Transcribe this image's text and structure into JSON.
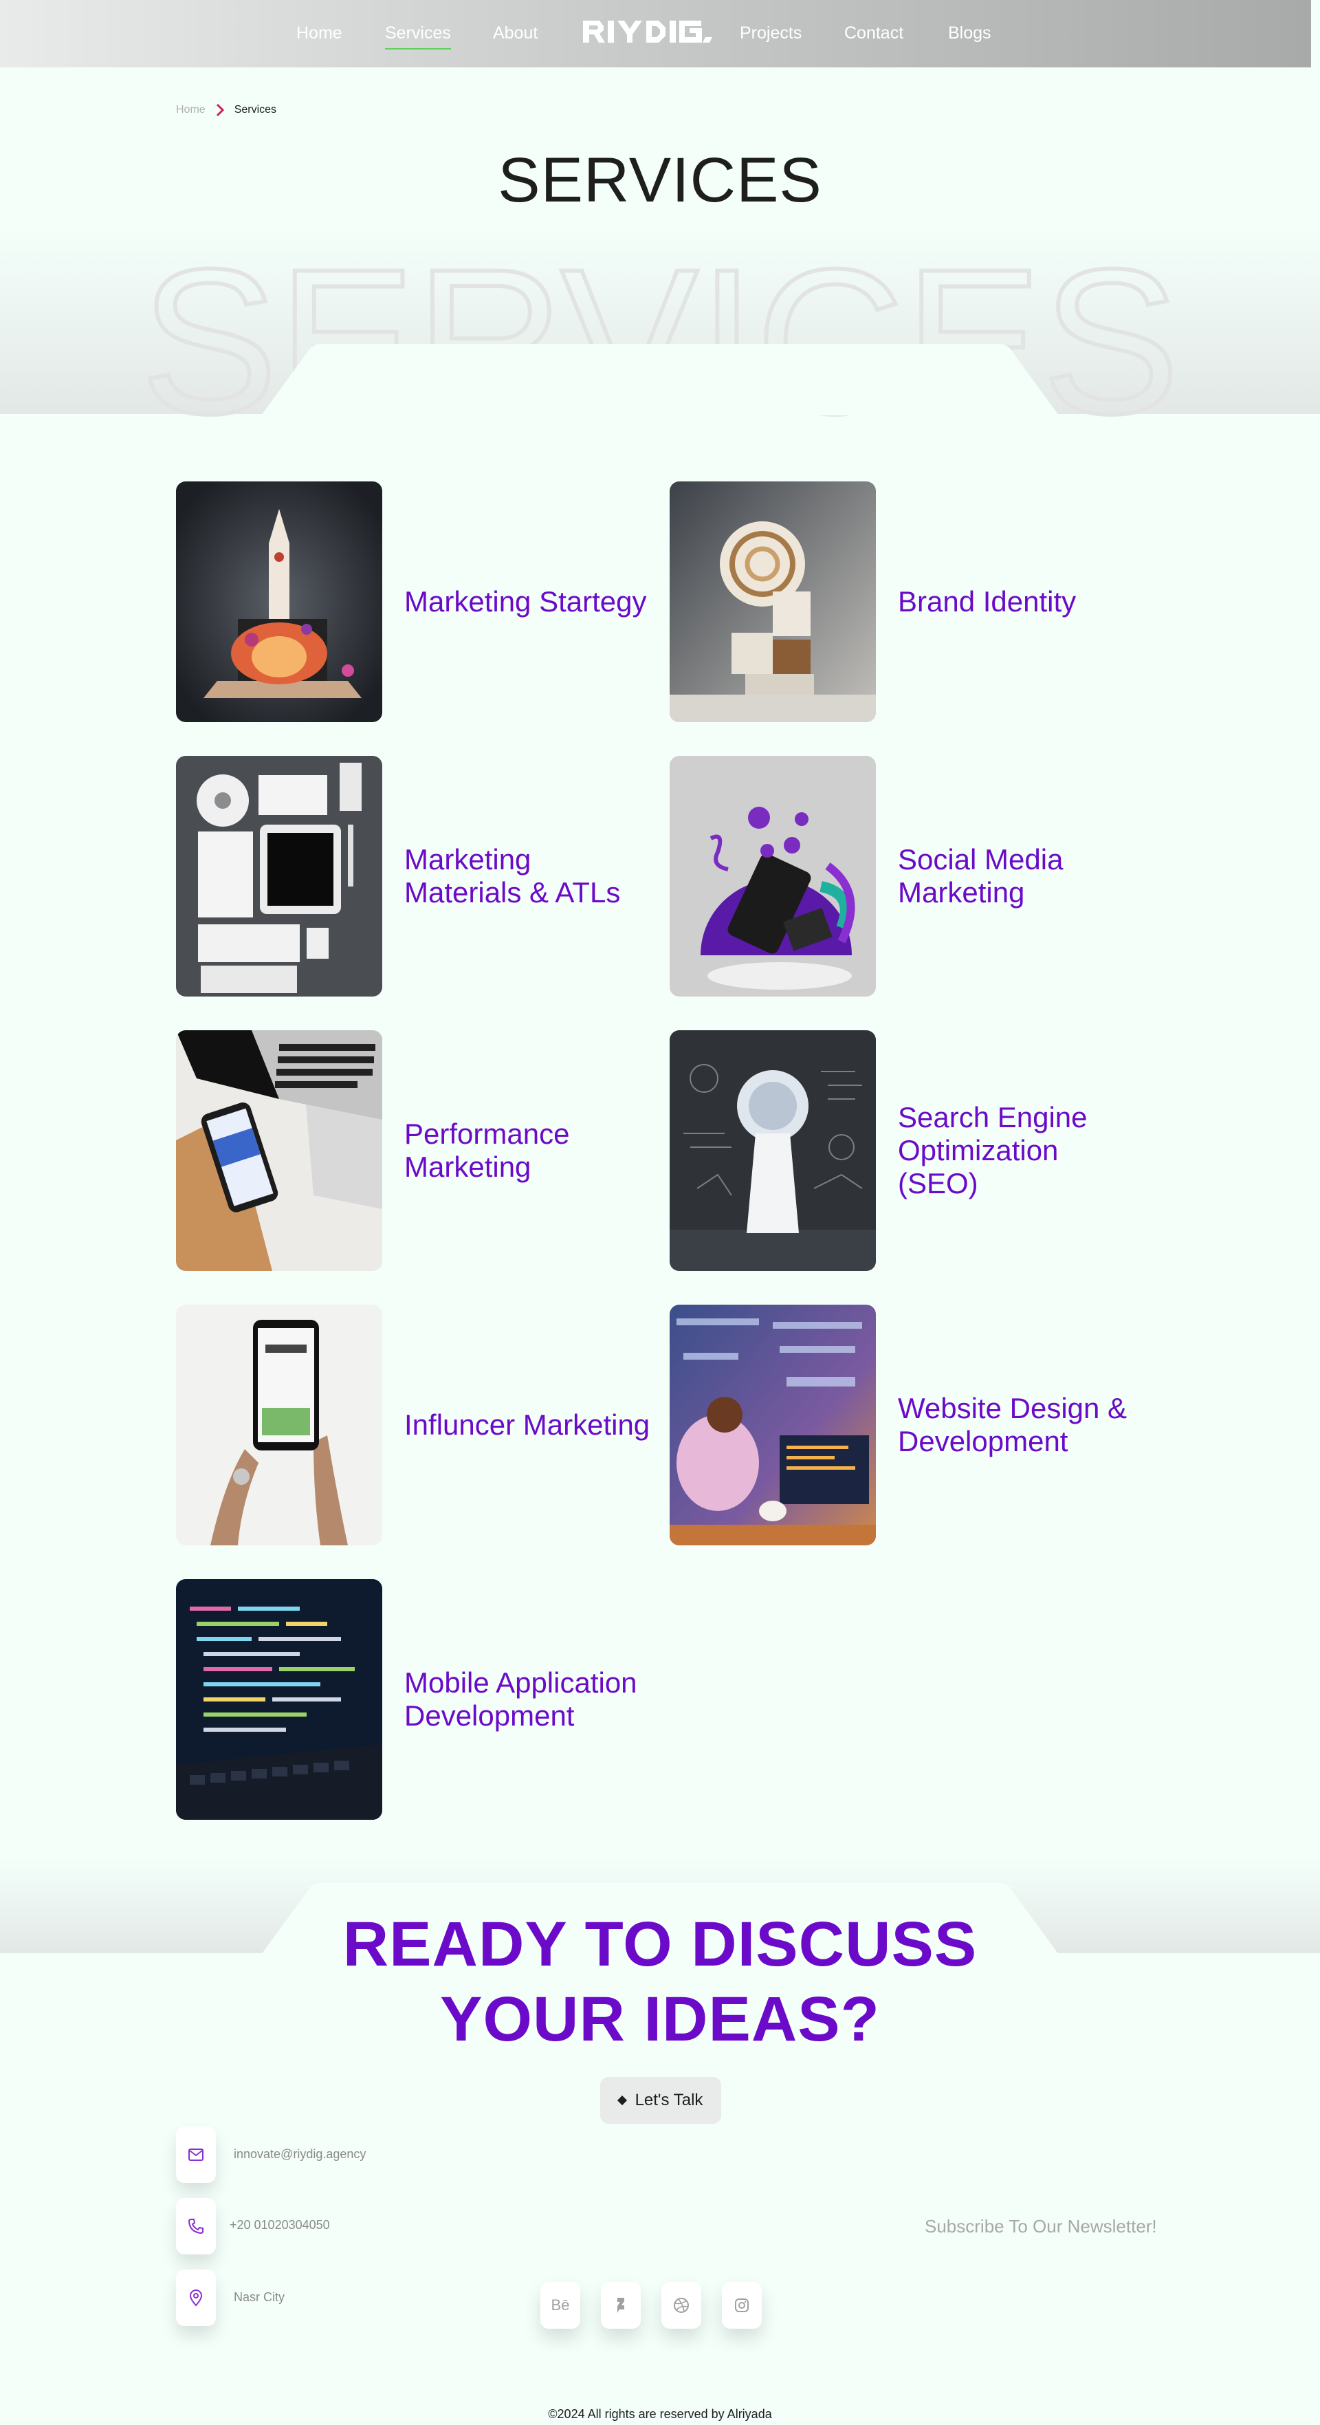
{
  "nav": {
    "items": [
      "Home",
      "Services",
      "About",
      "Projects",
      "Contact",
      "Blogs"
    ],
    "active": "Services",
    "logo_text": "RIYDIG",
    "underline_color": "#5fd05a"
  },
  "breadcrumb": {
    "home": "Home",
    "current": "Services"
  },
  "hero": {
    "title": "SERVICES",
    "watermark": "SERVICES"
  },
  "services": [
    {
      "name": "Marketing Startegy",
      "image": "rocket-illustration"
    },
    {
      "name": "Brand Identity",
      "image": "spiral-sculpture"
    },
    {
      "name": "Marketing Materials & ATLs",
      "image": "stationery-mockup"
    },
    {
      "name": "Social Media Marketing",
      "image": "social-phone-illustration"
    },
    {
      "name": "Performance Marketing",
      "image": "laptop-phone-desk"
    },
    {
      "name": "Search Engine Optimization (SEO)",
      "image": "keyhole-chalkboard"
    },
    {
      "name": "Influncer Marketing",
      "image": "hands-phone-connect"
    },
    {
      "name": "Website Design & Development",
      "image": "developer-html"
    },
    {
      "name": "Mobile Application Development",
      "image": "code-laptop"
    }
  ],
  "cta": {
    "line1": "READY TO DISCUSS",
    "line2_a": "YOUR ",
    "line2_b": "IDEAS?",
    "button": "Let's Talk"
  },
  "contact": {
    "email": "innovate@riydig.agency",
    "phone": "+20 01020304050",
    "address": "Nasr City"
  },
  "newsletter": "Subscribe To Our Newsletter!",
  "social": [
    {
      "label": "Bē",
      "icon": "behance-icon"
    },
    {
      "label": "",
      "icon": "deviantart-icon"
    },
    {
      "label": "",
      "icon": "dribbble-icon"
    },
    {
      "label": "",
      "icon": "instagram-icon"
    }
  ],
  "footer": {
    "copyright": "©2024 All rights are reserved by Alriyada"
  },
  "colors": {
    "accent": "#6b0ac9",
    "background": "#f4fffa",
    "active_underline": "#5fd05a"
  }
}
